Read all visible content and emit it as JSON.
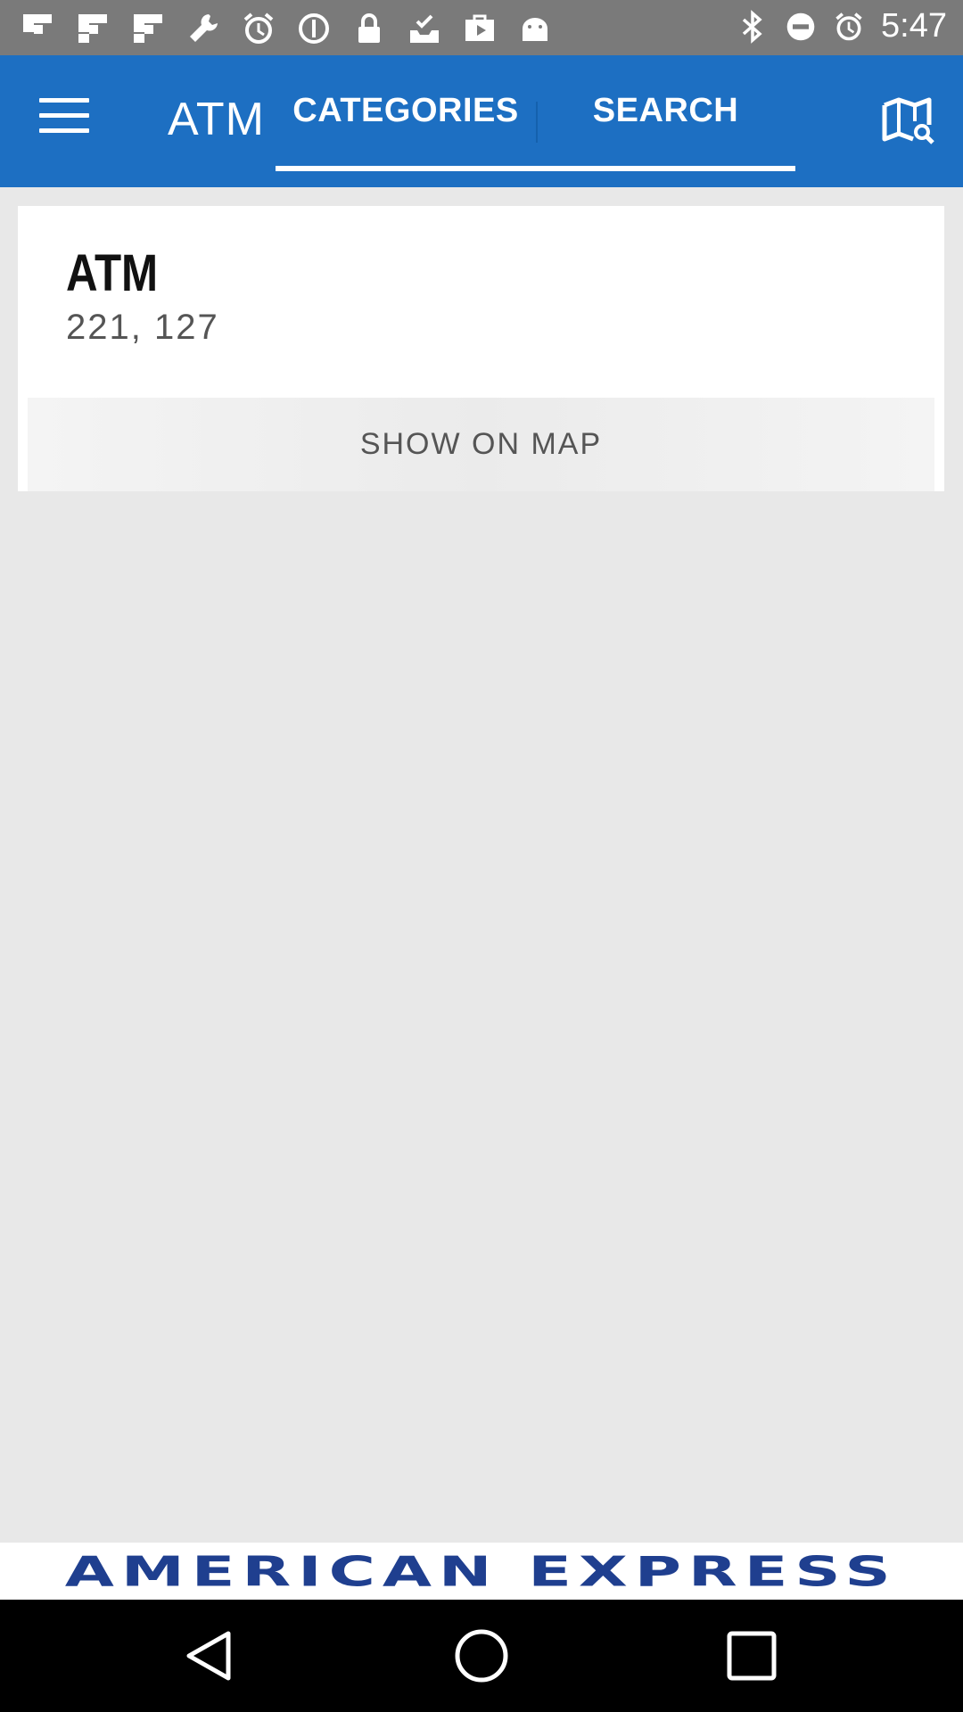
{
  "status_bar": {
    "time": "5:47",
    "icons": [
      "flipboard-icon",
      "flipboard-icon",
      "flipboard-icon",
      "wrench-icon",
      "alarm-icon",
      "blocked-icon",
      "lock-icon",
      "tray-check-icon",
      "play-store-icon",
      "android-icon",
      "bluetooth-icon",
      "do-not-disturb-icon",
      "alarm-icon"
    ]
  },
  "app_bar": {
    "title": "ATM",
    "tabs": [
      {
        "label": "CATEGORIES"
      },
      {
        "label": "SEARCH"
      }
    ],
    "menu_icon": "menu-icon",
    "map_search_icon": "map-search-icon"
  },
  "result": {
    "title": "ATM",
    "subtitle": "221, 127",
    "action_label": "SHOW ON MAP"
  },
  "ad": {
    "text": "AMERICAN EXPRESS",
    "color": "#1f3f8f"
  },
  "nav": {
    "icons": [
      "back-icon",
      "home-icon",
      "recents-icon"
    ]
  },
  "colors": {
    "app_bar": "#1d6fc2",
    "status_bar": "#7a7a7a",
    "background": "#e8e8e8"
  }
}
